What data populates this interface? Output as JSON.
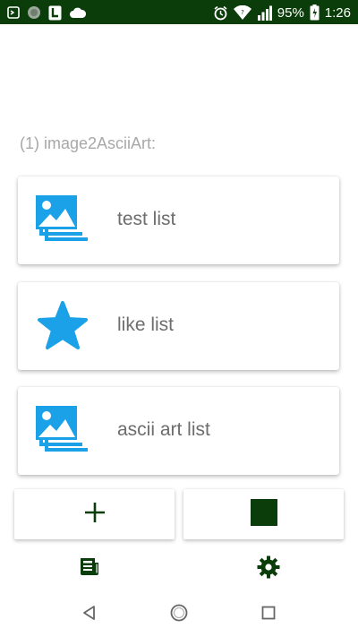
{
  "status_bar": {
    "battery": "95%",
    "time": "1:26",
    "icons": [
      "screenshot-icon",
      "circle-app-icon",
      "phone-app-icon",
      "cloud-icon",
      "alarm-icon",
      "wifi-icon",
      "signal-icon",
      "battery-icon"
    ]
  },
  "section_title": "(1) image2AsciiArt:",
  "lists": [
    {
      "label": "test list",
      "icon": "image-stack-icon"
    },
    {
      "label": "like list",
      "icon": "star-icon"
    },
    {
      "label": "ascii art list",
      "icon": "image-stack-icon"
    }
  ],
  "toolbar": {
    "add_icon": "plus-icon",
    "stop_icon": "stop-square-icon"
  },
  "bottom_nav": {
    "left_icon": "newspaper-icon",
    "right_icon": "gear-icon"
  },
  "system_nav": [
    "back-icon",
    "home-icon",
    "recents-icon"
  ],
  "colors": {
    "status_bar": "#0b3d0b",
    "accent_blue": "#1ba1e8",
    "dark_green": "#0b3d0b",
    "label_gray": "#6d6d6d",
    "title_gray": "#a8a8a8"
  }
}
